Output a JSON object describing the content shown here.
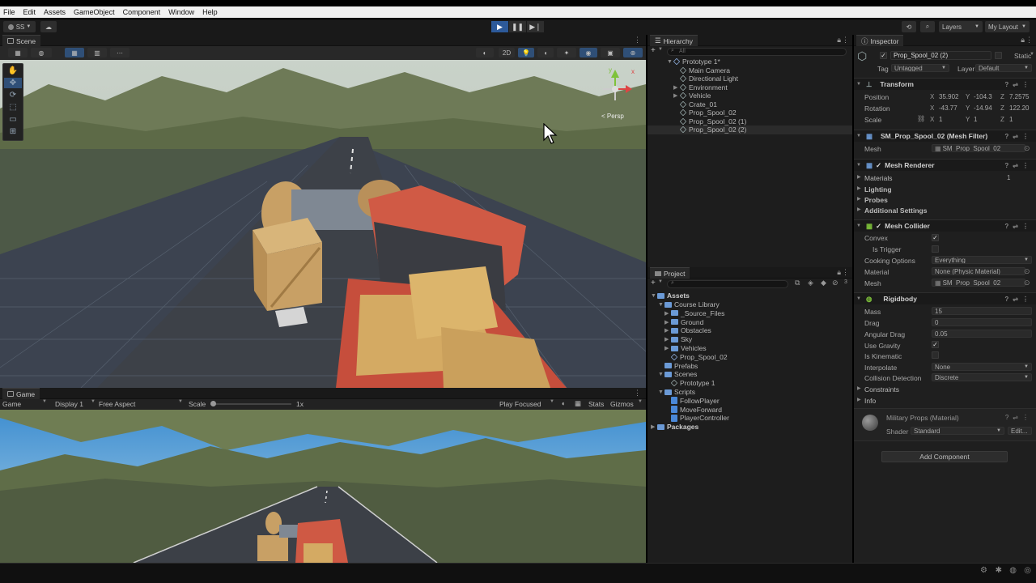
{
  "menubar": [
    "File",
    "Edit",
    "Assets",
    "GameObject",
    "Component",
    "Window",
    "Help"
  ],
  "toolbar": {
    "account": "SS",
    "layers": "Layers",
    "layout": "My Layout",
    "play_icon": "play-icon",
    "pause_icon": "pause-icon",
    "step_icon": "step-icon"
  },
  "scene": {
    "tab": "Scene",
    "mode_2d": "2D",
    "persp": "Persp",
    "gizmo_y": "y",
    "gizmo_x": "x"
  },
  "game": {
    "tab": "Game",
    "mode": "Game",
    "display": "Display 1",
    "aspect": "Free Aspect",
    "scale_label": "Scale",
    "scale_value": "1x",
    "play_focused": "Play Focused",
    "stats": "Stats",
    "gizmos": "Gizmos"
  },
  "hierarchy": {
    "tab": "Hierarchy",
    "search_placeholder": "All",
    "items": [
      {
        "label": "Prototype 1*",
        "depth": 0,
        "expanded": true
      },
      {
        "label": "Main Camera",
        "depth": 1
      },
      {
        "label": "Directional Light",
        "depth": 1
      },
      {
        "label": "Environment",
        "depth": 1,
        "collapsed": true
      },
      {
        "label": "Vehicle",
        "depth": 1,
        "collapsed": true
      },
      {
        "label": "Crate_01",
        "depth": 1
      },
      {
        "label": "Prop_Spool_02",
        "depth": 1
      },
      {
        "label": "Prop_Spool_02 (1)",
        "depth": 1
      },
      {
        "label": "Prop_Spool_02 (2)",
        "depth": 1,
        "selected": true
      }
    ]
  },
  "project": {
    "tab": "Project",
    "badge": "3",
    "items": [
      {
        "label": "Assets",
        "depth": 0,
        "type": "folder",
        "bold": true
      },
      {
        "label": "Course Library",
        "depth": 1,
        "type": "folder"
      },
      {
        "label": "_Source_Files",
        "depth": 2,
        "type": "folder"
      },
      {
        "label": "Ground",
        "depth": 2,
        "type": "folder"
      },
      {
        "label": "Obstacles",
        "depth": 2,
        "type": "folder"
      },
      {
        "label": "Sky",
        "depth": 2,
        "type": "folder"
      },
      {
        "label": "Vehicles",
        "depth": 2,
        "type": "folder"
      },
      {
        "label": "Prop_Spool_02",
        "depth": 2,
        "type": "prefab"
      },
      {
        "label": "Prefabs",
        "depth": 1,
        "type": "folder"
      },
      {
        "label": "Scenes",
        "depth": 1,
        "type": "folder"
      },
      {
        "label": "Prototype 1",
        "depth": 2,
        "type": "scene"
      },
      {
        "label": "Scripts",
        "depth": 1,
        "type": "folder"
      },
      {
        "label": "FollowPlayer",
        "depth": 2,
        "type": "script"
      },
      {
        "label": "MoveForward",
        "depth": 2,
        "type": "script"
      },
      {
        "label": "PlayerController",
        "depth": 2,
        "type": "script"
      },
      {
        "label": "Packages",
        "depth": 0,
        "type": "folder",
        "bold": true
      }
    ]
  },
  "inspector": {
    "tab": "Inspector",
    "object_name": "Prop_Spool_02 (2)",
    "static": "Static",
    "tag_label": "Tag",
    "tag_value": "Untagged",
    "layer_label": "Layer",
    "layer_value": "Default",
    "transform": {
      "title": "Transform",
      "position_label": "Position",
      "position": {
        "x": "35.902",
        "y": "-104.3",
        "z": "7.2575"
      },
      "rotation_label": "Rotation",
      "rotation": {
        "x": "-43.77",
        "y": "-14.94",
        "z": "122.20"
      },
      "scale_label": "Scale",
      "scale": {
        "x": "1",
        "y": "1",
        "z": "1"
      }
    },
    "mesh_filter": {
      "title": "SM_Prop_Spool_02 (Mesh Filter)",
      "mesh_label": "Mesh",
      "mesh_value": "SM_Prop_Spool_02"
    },
    "mesh_renderer": {
      "title": "Mesh Renderer",
      "materials": "Materials",
      "materials_count": "1",
      "lighting": "Lighting",
      "probes": "Probes",
      "additional": "Additional Settings"
    },
    "mesh_collider": {
      "title": "Mesh Collider",
      "convex": "Convex",
      "is_trigger": "Is Trigger",
      "cooking": "Cooking Options",
      "cooking_value": "Everything",
      "material": "Material",
      "material_value": "None (Physic Material)",
      "mesh": "Mesh",
      "mesh_value": "SM_Prop_Spool_02"
    },
    "rigidbody": {
      "title": "Rigidbody",
      "mass": "Mass",
      "mass_value": "15",
      "drag": "Drag",
      "drag_value": "0",
      "angular_drag": "Angular Drag",
      "angular_drag_value": "0.05",
      "use_gravity": "Use Gravity",
      "is_kinematic": "Is Kinematic",
      "interpolate": "Interpolate",
      "interpolate_value": "None",
      "collision": "Collision Detection",
      "collision_value": "Discrete",
      "constraints": "Constraints",
      "info": "Info"
    },
    "material": {
      "title": "Military Props (Material)",
      "shader_label": "Shader",
      "shader_value": "Standard",
      "edit": "Edit..."
    },
    "add_component": "Add Component"
  },
  "colors": {
    "accent": "#2d5a9a",
    "panel": "#191919",
    "inspector": "#1f1f1f"
  }
}
